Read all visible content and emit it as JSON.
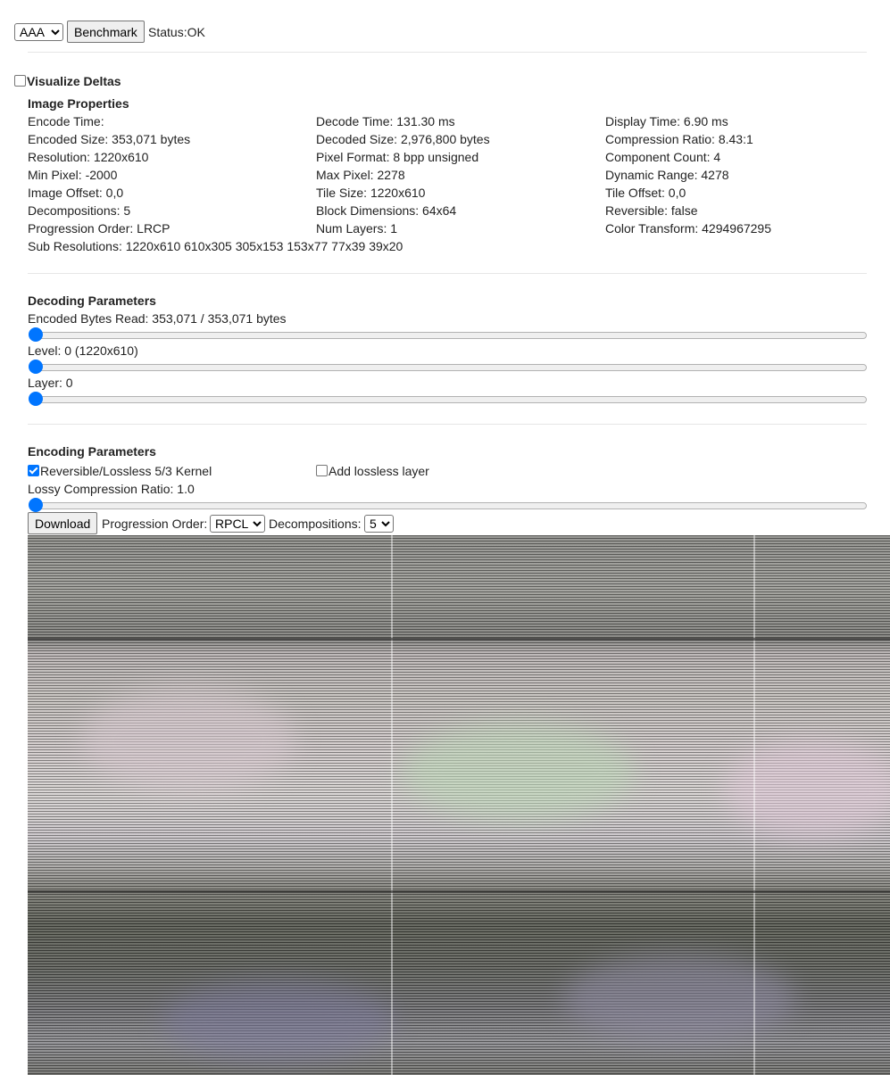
{
  "toolbar": {
    "file_select_value": "AAA",
    "benchmark_label": "Benchmark",
    "status_label": "Status:",
    "status_value": "OK"
  },
  "visualize_deltas": {
    "label": "Visualize Deltas",
    "checked": false
  },
  "image_properties": {
    "title": "Image Properties",
    "rows": [
      [
        "Encode Time:",
        "Decode Time: 131.30 ms",
        "Display Time: 6.90 ms"
      ],
      [
        "Encoded Size: 353,071 bytes",
        "Decoded Size: 2,976,800 bytes",
        "Compression Ratio: 8.43:1"
      ],
      [
        "Resolution: 1220x610",
        "Pixel Format: 8 bpp unsigned",
        "Component Count: 4"
      ],
      [
        "Min Pixel: -2000",
        "Max Pixel: 2278",
        "Dynamic Range: 4278"
      ],
      [
        "Image Offset: 0,0",
        "Tile Size: 1220x610",
        "Tile Offset: 0,0"
      ],
      [
        "Decompositions: 5",
        "Block Dimensions: 64x64",
        "Reversible: false"
      ],
      [
        "Progression Order: LRCP",
        "Num Layers: 1",
        "Color Transform: 4294967295"
      ]
    ],
    "sub_resolutions": "Sub Resolutions: 1220x610 610x305 305x153 153x77 77x39 39x20"
  },
  "decoding": {
    "title": "Decoding Parameters",
    "bytes_read_label": "Encoded Bytes Read: 353,071 / 353,071 bytes",
    "level_label": "Level: 0 (1220x610)",
    "layer_label": "Layer: 0",
    "bytes_slider_fraction": 0,
    "level_slider_fraction": 0,
    "layer_slider_fraction": 0
  },
  "encoding": {
    "title": "Encoding Parameters",
    "reversible_label": "Reversible/Lossless 5/3 Kernel",
    "reversible_checked": true,
    "lossless_layer_label": "Add lossless layer",
    "lossless_layer_checked": false,
    "lossy_ratio_label": "Lossy Compression Ratio: 1.0",
    "lossy_slider_fraction": 0,
    "download_label": "Download",
    "progression_order_label": "Progression Order:",
    "progression_order_value": "RPCL",
    "decompositions_label": "Decompositions:",
    "decompositions_value": "5"
  },
  "colors": {
    "accent": "#0075ff",
    "divider": "#e6e6e6"
  }
}
